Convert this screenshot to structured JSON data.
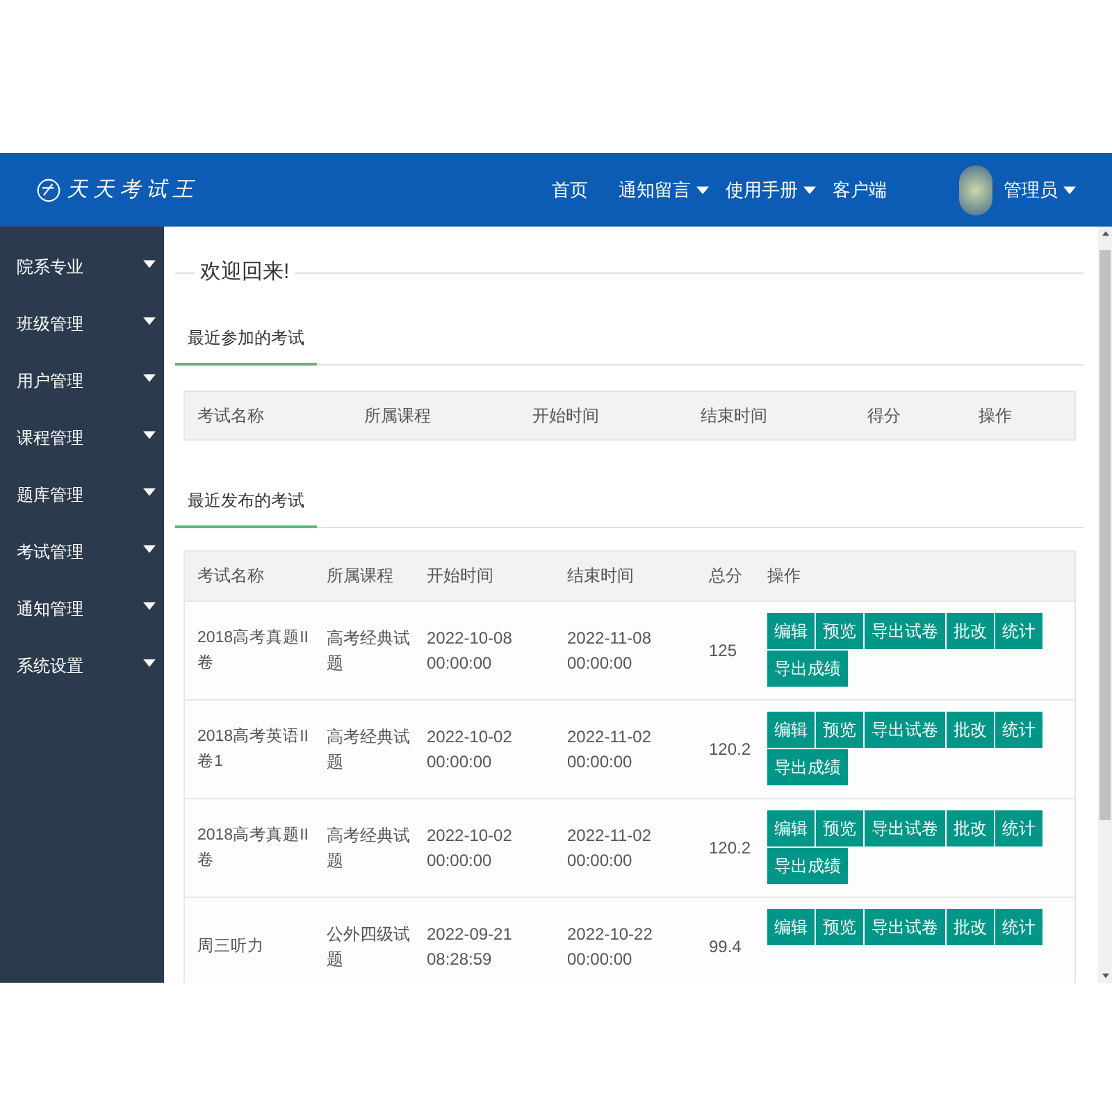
{
  "header": {
    "logo_text": "天天考试王",
    "nav": [
      {
        "label": "首页",
        "dropdown": false
      },
      {
        "label": "通知留言",
        "dropdown": true
      },
      {
        "label": "使用手册",
        "dropdown": true
      },
      {
        "label": "客户端",
        "dropdown": false
      }
    ],
    "user": {
      "name": "管理员"
    }
  },
  "sidebar": {
    "items": [
      {
        "label": "院系专业"
      },
      {
        "label": "班级管理"
      },
      {
        "label": "用户管理"
      },
      {
        "label": "课程管理"
      },
      {
        "label": "题库管理"
      },
      {
        "label": "考试管理"
      },
      {
        "label": "通知管理"
      },
      {
        "label": "系统设置"
      }
    ]
  },
  "welcome": "欢迎回来!",
  "recent_joined": {
    "tab": "最近参加的考试",
    "columns": [
      "考试名称",
      "所属课程",
      "开始时间",
      "结束时间",
      "得分",
      "操作"
    ]
  },
  "recent_published": {
    "tab": "最近发布的考试",
    "columns": [
      "考试名称",
      "所属课程",
      "开始时间",
      "结束时间",
      "总分",
      "操作"
    ],
    "rows": [
      {
        "name": "2018高考真题II卷",
        "course": "高考经典试题",
        "start": [
          "2022-10-08",
          "00:00:00"
        ],
        "end": [
          "2022-11-08",
          "00:00:00"
        ],
        "total": "125",
        "actions": [
          "编辑",
          "预览",
          "导出试卷",
          "批改",
          "统计",
          "导出成绩"
        ]
      },
      {
        "name": "2018高考英语II卷1",
        "course": "高考经典试题",
        "start": [
          "2022-10-02",
          "00:00:00"
        ],
        "end": [
          "2022-11-02",
          "00:00:00"
        ],
        "total": "120.2",
        "actions": [
          "编辑",
          "预览",
          "导出试卷",
          "批改",
          "统计",
          "导出成绩"
        ]
      },
      {
        "name": "2018高考真题II卷",
        "course": "高考经典试题",
        "start": [
          "2022-10-02",
          "00:00:00"
        ],
        "end": [
          "2022-11-02",
          "00:00:00"
        ],
        "total": "120.2",
        "actions": [
          "编辑",
          "预览",
          "导出试卷",
          "批改",
          "统计",
          "导出成绩"
        ]
      },
      {
        "name": "周三听力",
        "course": "公外四级试题",
        "start": [
          "2022-09-21",
          "08:28:59"
        ],
        "end": [
          "2022-10-22",
          "00:00:00"
        ],
        "total": "99.4",
        "actions": [
          "编辑",
          "预览",
          "导出试卷",
          "批改",
          "统计"
        ]
      }
    ]
  }
}
